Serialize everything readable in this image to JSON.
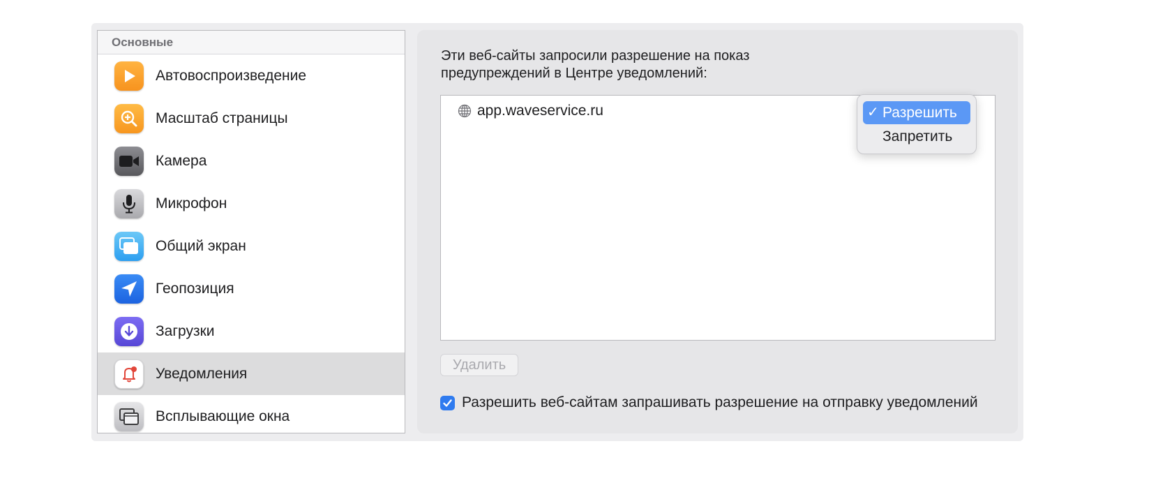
{
  "sidebar": {
    "header": "Основные",
    "items": [
      {
        "label": "Автовоспроизведение",
        "icon": "play-icon"
      },
      {
        "label": "Масштаб страницы",
        "icon": "zoom-icon"
      },
      {
        "label": "Камера",
        "icon": "camera-icon"
      },
      {
        "label": "Микрофон",
        "icon": "microphone-icon"
      },
      {
        "label": "Общий экран",
        "icon": "screen-share-icon"
      },
      {
        "label": "Геопозиция",
        "icon": "location-icon"
      },
      {
        "label": "Загрузки",
        "icon": "download-icon"
      },
      {
        "label": "Уведомления",
        "icon": "bell-icon",
        "selected": true
      },
      {
        "label": "Всплывающие окна",
        "icon": "popup-window-icon"
      }
    ]
  },
  "main": {
    "description_line1": "Эти веб-сайты запросили разрешение на показ",
    "description_line2": "предупреждений в Центре уведомлений:",
    "sites": [
      {
        "domain": "app.waveservice.ru",
        "icon": "globe-icon",
        "permission": "Разрешить"
      }
    ],
    "popup_menu": {
      "options": [
        "Разрешить",
        "Запретить"
      ],
      "selected": "Разрешить",
      "check_mark": "✓"
    },
    "delete_button": "Удалить",
    "allow_requests_checkbox": {
      "label": "Разрешить веб-сайтам запрашивать разрешение на отправку уведомлений",
      "checked": true
    }
  },
  "colors": {
    "accent": "#2f7bef",
    "selected_sidebar": "#dcdcdd",
    "menu_highlight": "#5b98f5"
  }
}
